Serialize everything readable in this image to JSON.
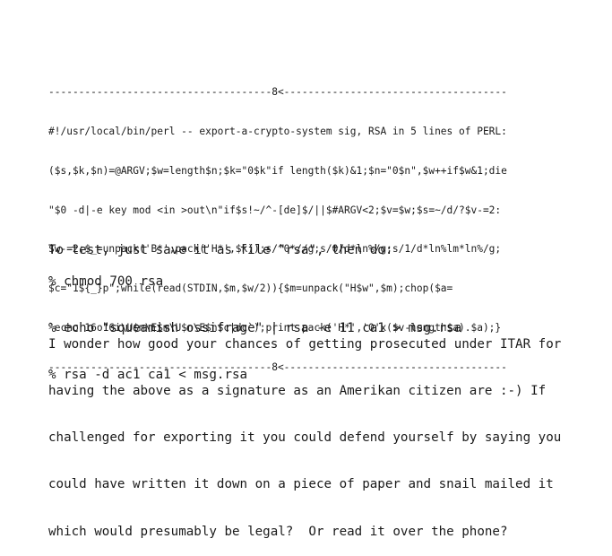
{
  "signature": {
    "cut_top": "-------------------------------------8<-------------------------------------",
    "lines": [
      "#!/usr/local/bin/perl -- export-a-crypto-system sig, RSA in 5 lines of PERL:",
      "($s,$k,$n)=@ARGV;$w=length$n;$k=\"0$k\"if length($k)&1;$n=\"0$n\",$w++if$w&1;die",
      "\"$0 -d|-e key mod <in >out\\n\"if$s!~/^-[de]$/||$#ARGV<2;$v=$w;$s=~/d/?$v-=2:",
      "$w-=2;$_=unpack('B*',pack('H*',$k));s/^0*//g;s/0/d*ln%/g;s/1/d*ln%lm*ln%/g;",
      "$c=\"1${_}p\";while(read(STDIN,$m,$w/2)){$m=unpack(\"H$w\",$m);chop($a=",
      "`echo 16o16i\\U$m\\E$m\\U$n\\E$n$c|dc`);print pack('H*','0'x($v-length$a).$a);}"
    ],
    "cut_bottom": "-------------------------------------8<-------------------------------------"
  },
  "test_intro": "To test, just save it as file \"rsa\", then do:",
  "commands": [
    "% chmod 700 rsa",
    "% echo \"squeamish ossifrage\" | rsa -e 11 ca1 > msg.rsa",
    "% rsa -d ac1 ca1 < msg.rsa"
  ],
  "paragraph_lines": [
    "I wonder how good your chances of getting prosecuted under ITAR for",
    "having the above as a signature as an Amerikan citizen are :-) If",
    "challenged for exporting it you could defend yourself by saying you",
    "could have written it down on a piece of paper and snail mailed it",
    "which would presumably be legal?  Or read it over the phone?"
  ]
}
